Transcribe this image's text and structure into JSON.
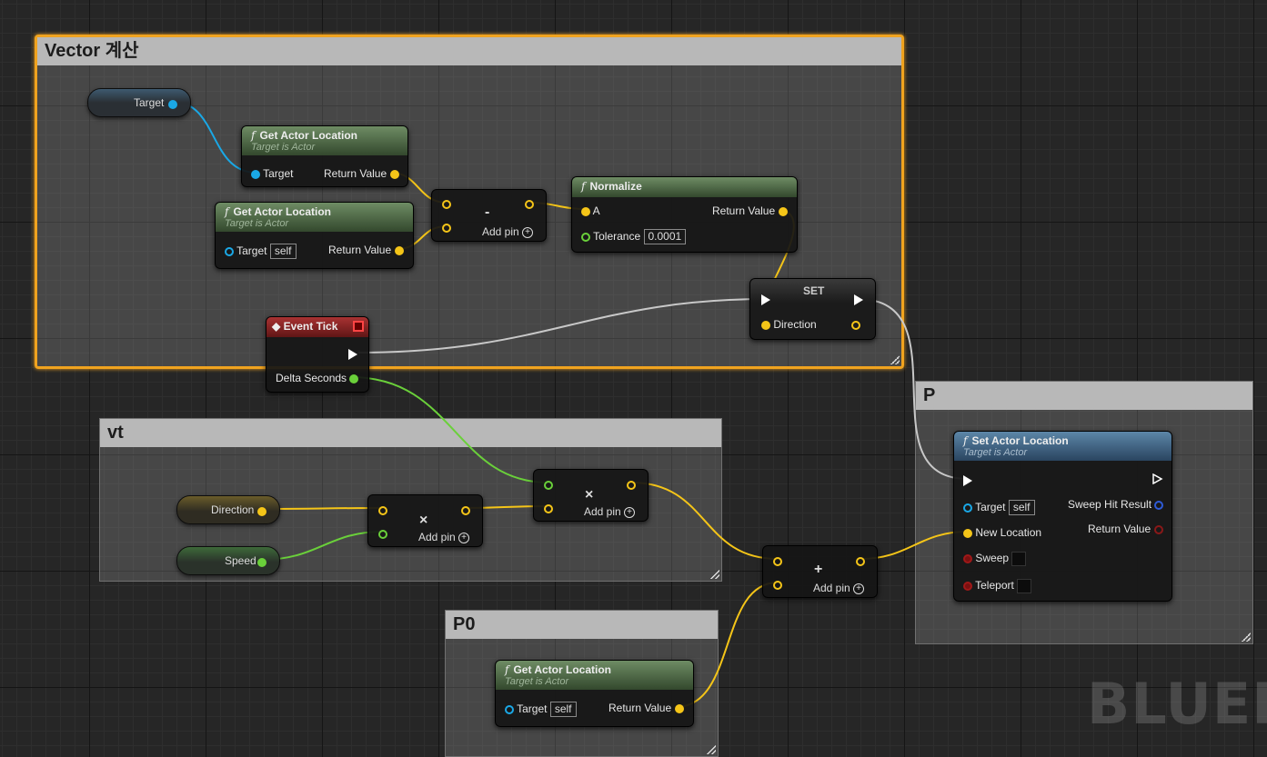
{
  "comments": {
    "vector": {
      "title": "Vector 계산"
    },
    "vt": {
      "title": "vt"
    },
    "p": {
      "title": "P"
    },
    "p0": {
      "title": "P0"
    }
  },
  "var_target": {
    "label": "Target"
  },
  "var_direction": {
    "label": "Direction"
  },
  "var_speed": {
    "label": "Speed"
  },
  "gal1": {
    "title": "Get Actor Location",
    "subtitle": "Target is Actor",
    "target": "Target",
    "ret": "Return Value"
  },
  "gal2": {
    "title": "Get Actor Location",
    "subtitle": "Target is Actor",
    "target": "Target",
    "target_value": "self",
    "ret": "Return Value"
  },
  "gal3": {
    "title": "Get Actor Location",
    "subtitle": "Target is Actor",
    "target": "Target",
    "target_value": "self",
    "ret": "Return Value"
  },
  "subtract": {
    "symbol": "-",
    "add_pin": "Add pin"
  },
  "normalize": {
    "title": "Normalize",
    "a": "A",
    "tolerance": "Tolerance",
    "tolerance_value": "0.0001",
    "ret": "Return Value"
  },
  "set": {
    "title": "SET",
    "direction": "Direction"
  },
  "event_tick": {
    "title": "Event Tick",
    "delta": "Delta Seconds"
  },
  "multiply1": {
    "symbol": "×",
    "add_pin": "Add pin"
  },
  "multiply2": {
    "symbol": "×",
    "add_pin": "Add pin"
  },
  "add": {
    "symbol": "+",
    "add_pin": "Add pin"
  },
  "set_actor_location": {
    "title": "Set Actor Location",
    "subtitle": "Target is Actor",
    "target": "Target",
    "target_value": "self",
    "new_location": "New Location",
    "sweep": "Sweep",
    "teleport": "Teleport",
    "sweep_hit": "Sweep Hit Result",
    "ret": "Return Value"
  },
  "watermark": "BLUEPR",
  "colors": {
    "vector_pin": "#f5c518",
    "object_pin": "#1aa8e6",
    "float_pin": "#6ad03a",
    "exec": "#ffffff",
    "selection": "#f0a31f"
  }
}
